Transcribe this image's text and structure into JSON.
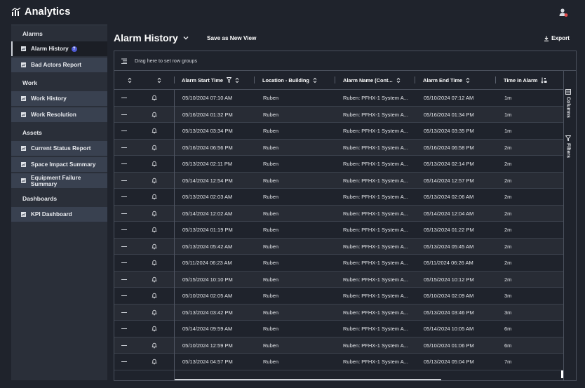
{
  "app": {
    "title": "Analytics"
  },
  "sidebar": {
    "sections": [
      {
        "heading": "Alarms",
        "items": [
          {
            "label": "Alarm History",
            "badge": "?",
            "active": true
          },
          {
            "label": "Bad Actors Report"
          }
        ]
      },
      {
        "heading": "Work",
        "items": [
          {
            "label": "Work History"
          },
          {
            "label": "Work Resolution"
          }
        ]
      },
      {
        "heading": "Assets",
        "items": [
          {
            "label": "Current Status Report"
          },
          {
            "label": "Space Impact Summary"
          },
          {
            "label": "Equipment Failure Summary"
          }
        ]
      },
      {
        "heading": "Dashboards",
        "items": [
          {
            "label": "KPI Dashboard"
          }
        ]
      }
    ]
  },
  "page": {
    "title": "Alarm History",
    "save_view_label": "Save as New View",
    "export_label": "Export",
    "group_panel_text": "Drag here to set row groups"
  },
  "grid": {
    "columns": {
      "start": "Alarm Start Time",
      "location": "Location - Building",
      "name": "Alarm Name (Cont...",
      "end": "Alarm End Time",
      "duration": "Time in Alarm"
    },
    "side_tabs": {
      "columns": "Columns",
      "filters": "Filters"
    },
    "rows": [
      {
        "start": "05/10/2024 07:10 AM",
        "location": "Ruben",
        "name": "Ruben: PFHX-1 System A...",
        "end": "05/10/2024 07:12 AM",
        "duration": "1m"
      },
      {
        "start": "05/16/2024 01:32 PM",
        "location": "Ruben",
        "name": "Ruben: PFHX-1 System A...",
        "end": "05/16/2024 01:34 PM",
        "duration": "1m"
      },
      {
        "start": "05/13/2024 03:34 PM",
        "location": "Ruben",
        "name": "Ruben: PFHX-1 System A...",
        "end": "05/13/2024 03:35 PM",
        "duration": "1m"
      },
      {
        "start": "05/16/2024 06:56 PM",
        "location": "Ruben",
        "name": "Ruben: PFHX-1 System A...",
        "end": "05/16/2024 06:58 PM",
        "duration": "2m"
      },
      {
        "start": "05/13/2024 02:11 PM",
        "location": "Ruben",
        "name": "Ruben: PFHX-1 System A...",
        "end": "05/13/2024 02:14 PM",
        "duration": "2m"
      },
      {
        "start": "05/14/2024 12:54 PM",
        "location": "Ruben",
        "name": "Ruben: PFHX-1 System A...",
        "end": "05/14/2024 12:57 PM",
        "duration": "2m"
      },
      {
        "start": "05/13/2024 02:03 AM",
        "location": "Ruben",
        "name": "Ruben: PFHX-1 System A...",
        "end": "05/13/2024 02:06 AM",
        "duration": "2m"
      },
      {
        "start": "05/14/2024 12:02 AM",
        "location": "Ruben",
        "name": "Ruben: PFHX-1 System A...",
        "end": "05/14/2024 12:04 AM",
        "duration": "2m"
      },
      {
        "start": "05/13/2024 01:19 PM",
        "location": "Ruben",
        "name": "Ruben: PFHX-1 System A...",
        "end": "05/13/2024 01:22 PM",
        "duration": "2m"
      },
      {
        "start": "05/13/2024 05:42 AM",
        "location": "Ruben",
        "name": "Ruben: PFHX-1 System A...",
        "end": "05/13/2024 05:45 AM",
        "duration": "2m"
      },
      {
        "start": "05/11/2024 06:23 AM",
        "location": "Ruben",
        "name": "Ruben: PFHX-1 System A...",
        "end": "05/11/2024 06:26 AM",
        "duration": "2m"
      },
      {
        "start": "05/15/2024 10:10 PM",
        "location": "Ruben",
        "name": "Ruben: PFHX-1 System A...",
        "end": "05/15/2024 10:12 PM",
        "duration": "2m"
      },
      {
        "start": "05/10/2024 02:05 AM",
        "location": "Ruben",
        "name": "Ruben: PFHX-1 System A...",
        "end": "05/10/2024 02:09 AM",
        "duration": "3m"
      },
      {
        "start": "05/13/2024 03:42 PM",
        "location": "Ruben",
        "name": "Ruben: PFHX-1 System A...",
        "end": "05/13/2024 03:46 PM",
        "duration": "3m"
      },
      {
        "start": "05/14/2024 09:59 AM",
        "location": "Ruben",
        "name": "Ruben: PFHX-1 System A...",
        "end": "05/14/2024 10:05 AM",
        "duration": "6m"
      },
      {
        "start": "05/10/2024 12:59 PM",
        "location": "Ruben",
        "name": "Ruben: PFHX-1 System A...",
        "end": "05/10/2024 01:06 PM",
        "duration": "6m"
      },
      {
        "start": "05/13/2024 04:57 PM",
        "location": "Ruben",
        "name": "Ruben: PFHX-1 System A...",
        "end": "05/13/2024 05:04 PM",
        "duration": "7m"
      }
    ]
  },
  "colors": {
    "background": "#1f232c",
    "sidebar": "#2a2f39",
    "nav_item": "#394150",
    "nav_active": "#1b1e25",
    "badge": "#4f5bd5"
  }
}
